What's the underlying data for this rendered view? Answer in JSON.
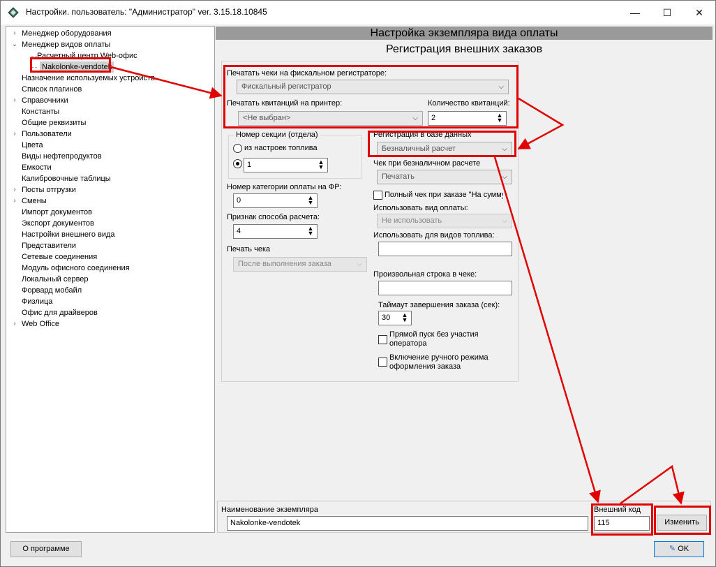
{
  "window": {
    "title": "Настройки. пользователь: \"Администратор\" ver. 3.15.18.10845",
    "minimize": "—",
    "maximize": "☐",
    "close": "✕"
  },
  "tree": {
    "items": [
      {
        "label": "Менеджер оборудования",
        "expander": "›"
      },
      {
        "label": "Менеджер видов оплаты",
        "expander": "⌄"
      },
      {
        "label": "Расчетный центр Web-офис",
        "expander": ""
      },
      {
        "label": "Nakolonke-vendotek",
        "expander": ""
      },
      {
        "label": "Назначение используемых устройств",
        "expander": ""
      },
      {
        "label": "Список плагинов",
        "expander": ""
      },
      {
        "label": "Справочники",
        "expander": "›"
      },
      {
        "label": "Константы",
        "expander": ""
      },
      {
        "label": "Общие реквизиты",
        "expander": ""
      },
      {
        "label": "Пользователи",
        "expander": "›"
      },
      {
        "label": "Цвета",
        "expander": ""
      },
      {
        "label": "Виды нефтепродуктов",
        "expander": ""
      },
      {
        "label": "Емкости",
        "expander": ""
      },
      {
        "label": "Калибровочные таблицы",
        "expander": ""
      },
      {
        "label": "Посты отгрузки",
        "expander": "›"
      },
      {
        "label": "Смены",
        "expander": "›"
      },
      {
        "label": "Импорт документов",
        "expander": ""
      },
      {
        "label": "Экспорт документов",
        "expander": ""
      },
      {
        "label": "Настройки внешнего вида",
        "expander": ""
      },
      {
        "label": "Представители",
        "expander": ""
      },
      {
        "label": "Сетевые соединения",
        "expander": ""
      },
      {
        "label": "Модуль офисного соединения",
        "expander": ""
      },
      {
        "label": "Локальный сервер",
        "expander": ""
      },
      {
        "label": "Форвард мобайл",
        "expander": ""
      },
      {
        "label": "Физлица",
        "expander": ""
      },
      {
        "label": "Офис для драйверов",
        "expander": ""
      },
      {
        "label": "Web Office",
        "expander": "›"
      }
    ]
  },
  "panel": {
    "header": "Настройка экземпляра вида оплаты",
    "subheader": "Регистрация внешних заказов",
    "fiscal_label": "Печатать чеки на фискальном регистраторе:",
    "fiscal_value": "Фискальный регистратор",
    "printer_label": "Печатать квитанций на принтер:",
    "printer_value": "<Не выбран>",
    "receipts_count_label": "Количество квитанций:",
    "receipts_count_value": "2",
    "section_group_label": "Номер секции (отдела)",
    "radio_from_fuel": "из настроек топлива",
    "section_value": "1",
    "payment_category_label": "Номер категории оплаты на ФР:",
    "payment_category_value": "0",
    "calc_method_label": "Признак способа расчета:",
    "calc_method_value": "4",
    "print_check_label": "Печать чека",
    "print_check_value": "После выполнения заказа",
    "db_registration_label": "Регистрация в базе данных",
    "db_registration_value": "Безналичный расчет",
    "cashless_check_label": "Чек при безналичном расчете",
    "cashless_check_value": "Печатать",
    "full_check_label": "Полный чек при заказе \"На сумму",
    "use_payment_type_label": "Использовать вид оплаты:",
    "use_payment_type_value": "Не использовать",
    "fuel_types_label": "Использовать для видов топлива:",
    "fuel_types_value": "",
    "custom_line_label": "Произвольная строка в чеке:",
    "custom_line_value": "",
    "timeout_label": "Таймаут завершения заказа (сек):",
    "timeout_value": "30",
    "direct_start_label": "Прямой пуск без участия оператора",
    "manual_mode_label": "Включение ручного режима оформления заказа",
    "instance_name_label": "Наименование экземпляра",
    "instance_name_value": "Nakolonke-vendotek",
    "external_code_label": "Внешний код",
    "external_code_value": "115",
    "change_button": "Изменить"
  },
  "footer": {
    "about_button": "О программе",
    "ok_button": "OK"
  },
  "colors": {
    "annotation_red": "#e00000",
    "header_gray": "#9a9a9a",
    "window_bg": "#f0f0f0"
  }
}
